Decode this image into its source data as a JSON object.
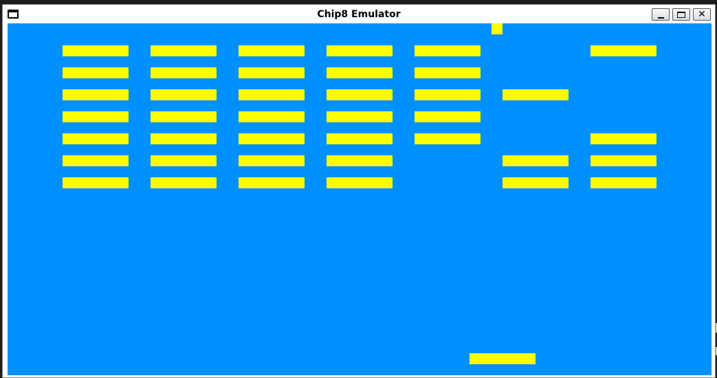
{
  "window": {
    "title": "Chip8 Emulator",
    "buttons": {
      "minimize": "minimize",
      "maximize": "maximize",
      "close": "close"
    }
  },
  "colors": {
    "background": "#0090ff",
    "foreground": "#ffff00"
  },
  "display": {
    "columns": 64,
    "rows": 32
  },
  "game": {
    "brick_rows": [
      [
        1,
        1,
        1,
        1,
        1,
        0,
        1
      ],
      [
        1,
        1,
        1,
        1,
        1,
        0,
        0
      ],
      [
        1,
        1,
        1,
        1,
        1,
        1,
        0
      ],
      [
        1,
        1,
        1,
        1,
        1,
        0,
        0
      ],
      [
        1,
        1,
        1,
        1,
        1,
        0,
        1
      ],
      [
        1,
        1,
        1,
        1,
        0,
        1,
        1
      ],
      [
        1,
        1,
        1,
        1,
        0,
        1,
        1
      ]
    ],
    "ball": {
      "col": 44,
      "row": 0
    },
    "paddle": {
      "col": 42,
      "row": 30,
      "width": 6
    }
  }
}
